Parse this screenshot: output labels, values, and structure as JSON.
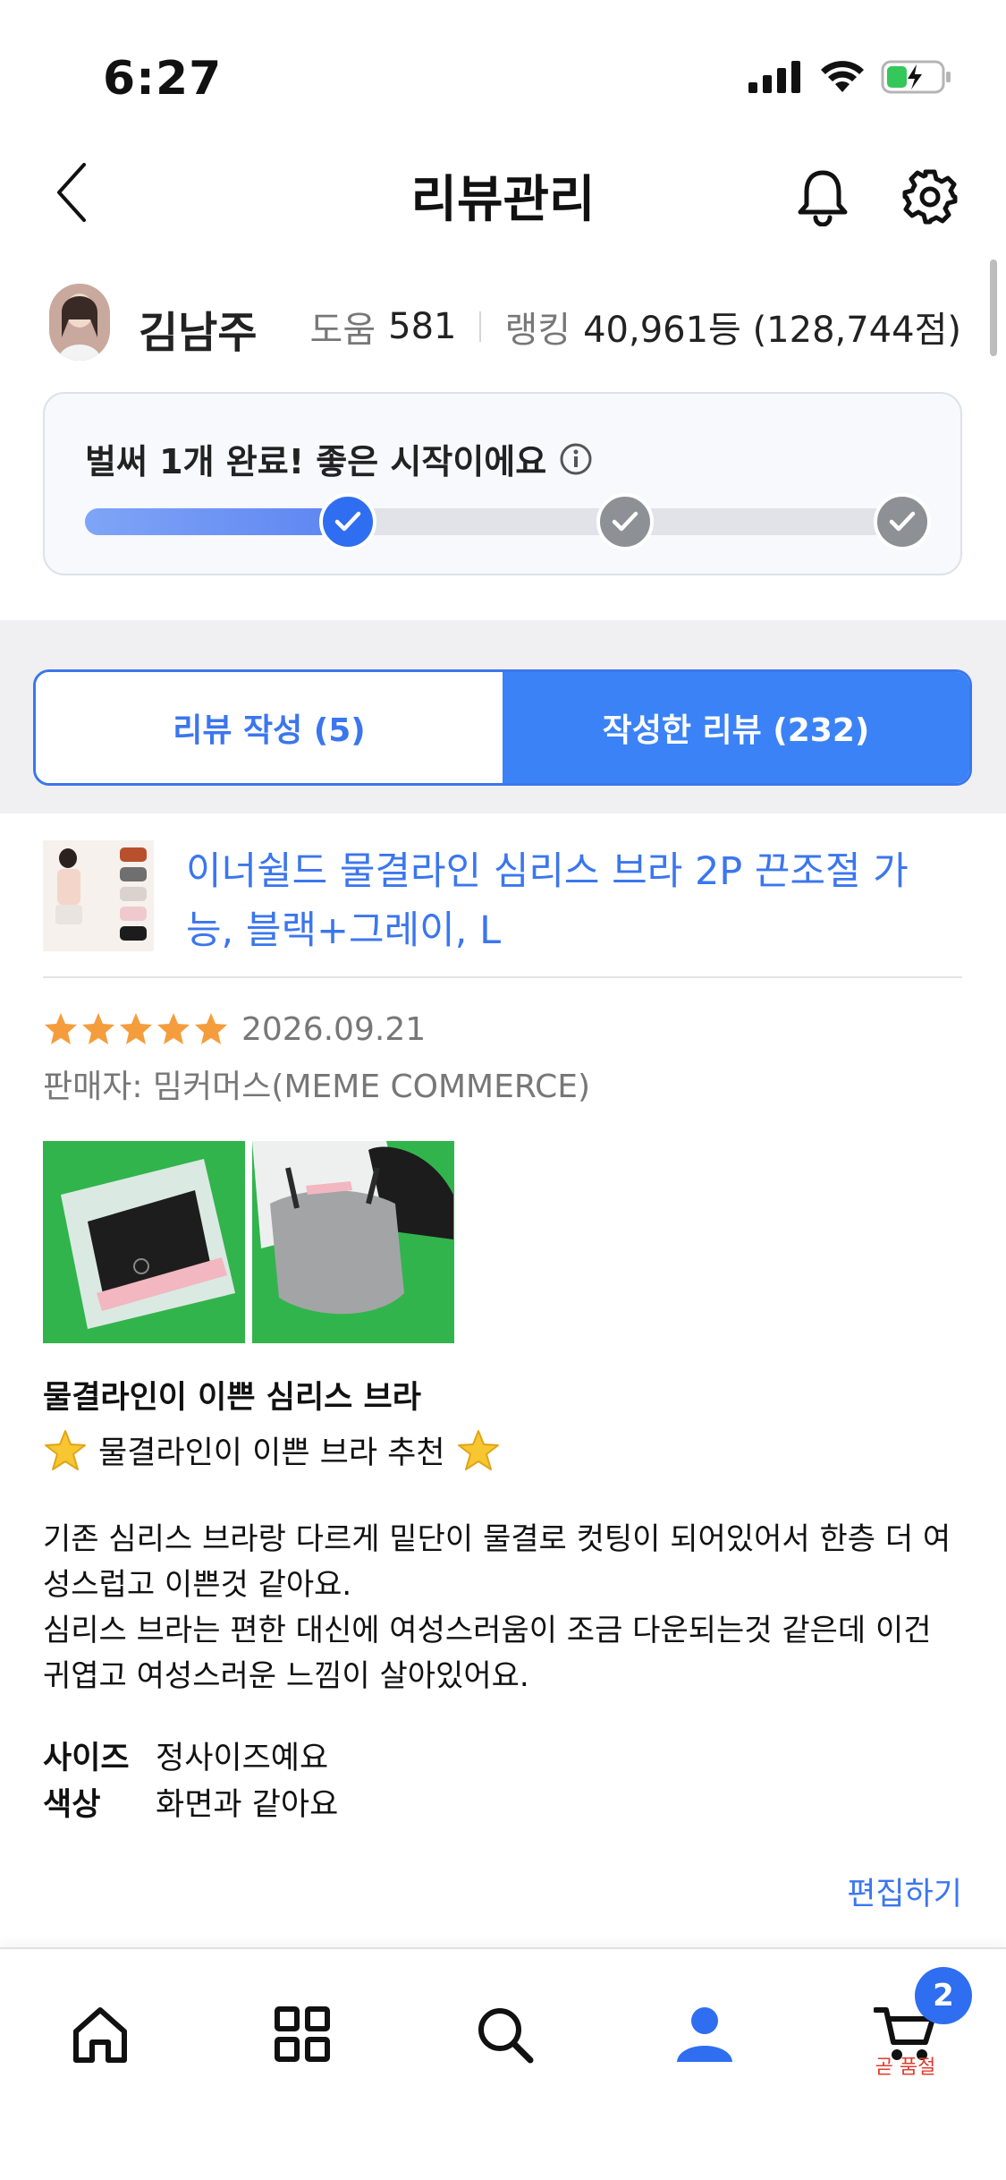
{
  "status": {
    "time": "6:27"
  },
  "header": {
    "title": "리뷰관리"
  },
  "profile": {
    "name": "김남주",
    "help_label": "도움",
    "help_value": "581",
    "rank_label": "랭킹",
    "rank_value": "40,961등 (128,744점)"
  },
  "progress": {
    "message": "벌써 1개 완료! 좋은 시작이에요",
    "completed_fraction": 0.3,
    "steps_total": 3,
    "steps_done": 1
  },
  "tabs": [
    {
      "label": "리뷰 작성 (5)",
      "active": false
    },
    {
      "label": "작성한 리뷰 (232)",
      "active": true
    }
  ],
  "review": {
    "product_title": "이너쉴드 물결라인 심리스 브라 2P 끈조절 가능, 블랙+그레이, L",
    "rating": 5,
    "date": "2026.09.21",
    "seller": "판매자: 밈커머스(MEME COMMERCE)",
    "headline": "물결라인이 이쁜 심리스 브라",
    "subline": "물결라인이 이쁜 브라 추천",
    "body_1": "기존 심리스 브라랑 다르게 밑단이 물결로 컷팅이 되어있어서 한층 더 여성스럽고 이쁜것 같아요.",
    "body_2": "심리스 브라는 편한 대신에 여성스러움이 조금 다운되는것 같은데 이건 귀엽고 여성스러운 느낌이 살아있어요.",
    "size_label": "사이즈",
    "size_value": "정사이즈예요",
    "color_label": "색상",
    "color_value": "화면과 같아요",
    "edit_label": "편집하기"
  },
  "nav": {
    "cart_count": "2",
    "cart_note": "곧 품절"
  },
  "colors": {
    "accent": "#3b76ee",
    "tab_active": "#3b82f6",
    "star": "#f59d3d",
    "sold_out": "#e33b2e"
  }
}
